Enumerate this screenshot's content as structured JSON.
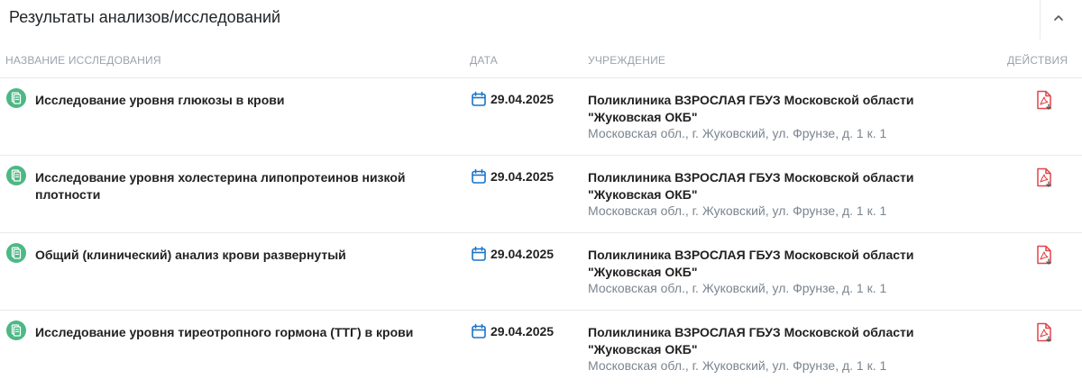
{
  "panel": {
    "title": "Результаты анализов/исследований"
  },
  "columns": {
    "name": "НАЗВАНИЕ ИССЛЕДОВАНИЯ",
    "date": "ДАТА",
    "institution": "УЧРЕЖДЕНИЕ",
    "actions": "ДЕЙСТВИЯ"
  },
  "rows": [
    {
      "name": "Исследование уровня глюкозы в крови",
      "date": "29.04.2025",
      "institution": "Поликлиника ВЗРОСЛАЯ ГБУЗ Московской области \"Жуковская ОКБ\"",
      "address": "Московская обл., г. Жуковский, ул. Фрунзе, д. 1 к. 1"
    },
    {
      "name": "Исследование уровня холестерина липопротеинов низкой плотности",
      "date": "29.04.2025",
      "institution": "Поликлиника ВЗРОСЛАЯ ГБУЗ Московской области \"Жуковская ОКБ\"",
      "address": "Московская обл., г. Жуковский, ул. Фрунзе, д. 1 к. 1"
    },
    {
      "name": "Общий (клинический) анализ крови развернутый",
      "date": "29.04.2025",
      "institution": "Поликлиника ВЗРОСЛАЯ ГБУЗ Московской области \"Жуковская ОКБ\"",
      "address": "Московская обл., г. Жуковский, ул. Фрунзе, д. 1 к. 1"
    },
    {
      "name": "Исследование уровня тиреотропного гормона (ТТГ) в крови",
      "date": "29.04.2025",
      "institution": "Поликлиника ВЗРОСЛАЯ ГБУЗ Московской области \"Жуковская ОКБ\"",
      "address": "Московская обл., г. Жуковский, ул. Фрунзе, д. 1 к. 1"
    }
  ],
  "icons": {
    "header_toggle": "chevron-up-icon",
    "row_type": "lab-document-icon",
    "date": "calendar-icon",
    "action": "pdf-download-icon"
  },
  "colors": {
    "lab_icon": "#4cb885",
    "calendar_icon": "#1a73c8",
    "pdf_icon": "#e0454a",
    "column_header": "#9aa3ad",
    "address_text": "#7a8590"
  }
}
